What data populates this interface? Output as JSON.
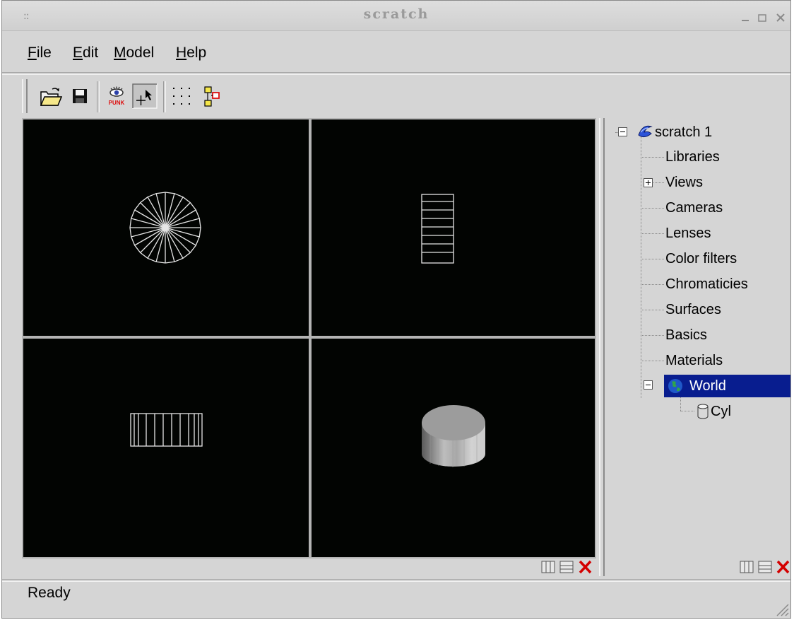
{
  "window": {
    "title": "scratch",
    "grip": "::"
  },
  "menu": {
    "file": {
      "mnemonic": "F",
      "rest": "ile"
    },
    "edit": {
      "mnemonic": "E",
      "rest": "dit"
    },
    "model": {
      "mnemonic": "M",
      "rest": "odel"
    },
    "help": {
      "mnemonic": "H",
      "rest": "elp"
    }
  },
  "toolbar": {
    "buttons": [
      "open-folder-icon",
      "save-disk-icon",
      "punk-eye-icon",
      "select-arrow-icon",
      "grid-dots-icon",
      "connect-nodes-icon"
    ],
    "punk_label": "PUNK",
    "pressed": "select-arrow-icon"
  },
  "viewports": {
    "background": "#020402",
    "wire_color": "#e6e6e6",
    "views": [
      "top-wireframe-disc",
      "front-wireframe-rect",
      "side-wireframe-rect",
      "shaded-cylinder"
    ]
  },
  "tree": {
    "root": {
      "label": "scratch 1",
      "icon": "scene-swirl-icon",
      "expanded": true
    },
    "items": [
      {
        "label": "Libraries"
      },
      {
        "label": "Views",
        "collapsed": true
      },
      {
        "label": "Cameras"
      },
      {
        "label": "Lenses"
      },
      {
        "label": "Color filters"
      },
      {
        "label": "Chromaticies"
      },
      {
        "label": "Surfaces"
      },
      {
        "label": "Basics"
      },
      {
        "label": "Materials"
      },
      {
        "label": "World",
        "icon": "globe-icon",
        "selected": true,
        "expanded": true
      }
    ],
    "child": {
      "label": "Cyl",
      "icon": "cylinder-icon"
    },
    "selection_color": "#081d8f"
  },
  "status": {
    "text": "Ready"
  }
}
